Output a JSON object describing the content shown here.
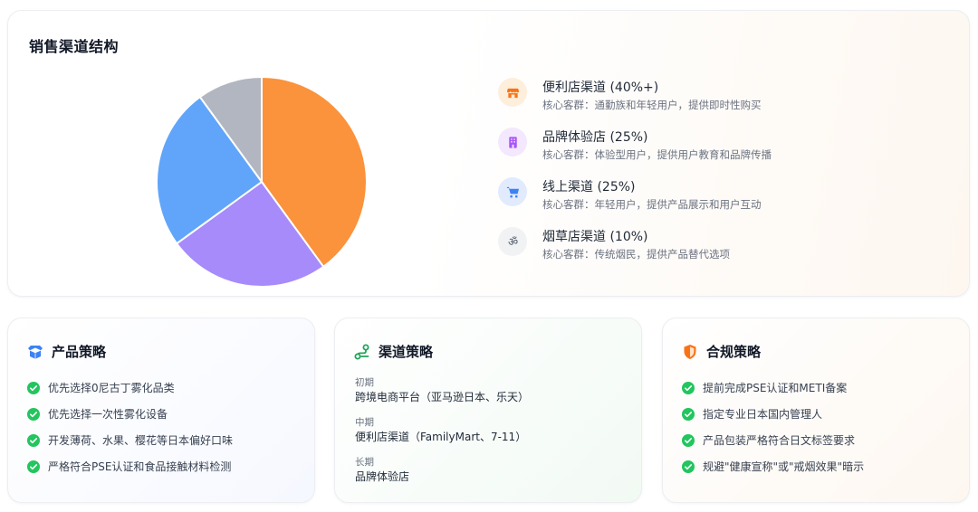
{
  "top": {
    "title": "销售渠道结构"
  },
  "chart_data": {
    "type": "pie",
    "categories": [
      "便利店渠道",
      "品牌体验店",
      "线上渠道",
      "烟草店渠道"
    ],
    "values": [
      40,
      25,
      25,
      10
    ],
    "colors": [
      "#fb923c",
      "#a78bfa",
      "#60a5fa",
      "#b2b6c0"
    ],
    "legend": [
      {
        "name": "便利店渠道 (40%+)",
        "desc": "核心客群：通勤族和年轻用户，提供即时性购买",
        "icon": "store-icon",
        "icon_color": "#f97316",
        "icon_bg": "#fdefdc"
      },
      {
        "name": "品牌体验店 (25%)",
        "desc": "核心客群：体验型用户，提供用户教育和品牌传播",
        "icon": "building-icon",
        "icon_color": "#a855f7",
        "icon_bg": "#f3e8fd"
      },
      {
        "name": "线上渠道 (25%)",
        "desc": "核心客群：年轻用户，提供产品展示和用户互动",
        "icon": "cart-icon",
        "icon_color": "#3b82f6",
        "icon_bg": "#e1ebfd"
      },
      {
        "name": "烟草店渠道 (10%)",
        "desc": "核心客群：传统烟民，提供产品替代选项",
        "icon": "om-icon",
        "icon_color": "#4b5563",
        "icon_bg": "#f1f2f4"
      }
    ],
    "legend_placement": "right"
  },
  "product": {
    "title": "产品策略",
    "icon": "box-icon",
    "icon_color": "#3b82f6",
    "items": [
      "优先选择0尼古丁雾化品类",
      "优先选择一次性雾化设备",
      "开发薄荷、水果、樱花等日本偏好口味",
      "严格符合PSE认证和食品接触材料检测"
    ]
  },
  "channel": {
    "title": "渠道策略",
    "icon": "route-icon",
    "icon_color": "#22a35a",
    "phases": [
      {
        "label": "初期",
        "text": "跨境电商平台（亚马逊日本、乐天）"
      },
      {
        "label": "中期",
        "text": "便利店渠道（FamilyMart、7-11）"
      },
      {
        "label": "长期",
        "text": "品牌体验店"
      }
    ]
  },
  "compliance": {
    "title": "合规策略",
    "icon": "shield-icon",
    "icon_color": "#f97316",
    "items": [
      "提前完成PSE认证和METI备案",
      "指定专业日本国内管理人",
      "产品包装严格符合日文标签要求",
      "规避\"健康宣称\"或\"戒烟效果\"暗示"
    ]
  },
  "check_color": "#22c55e"
}
